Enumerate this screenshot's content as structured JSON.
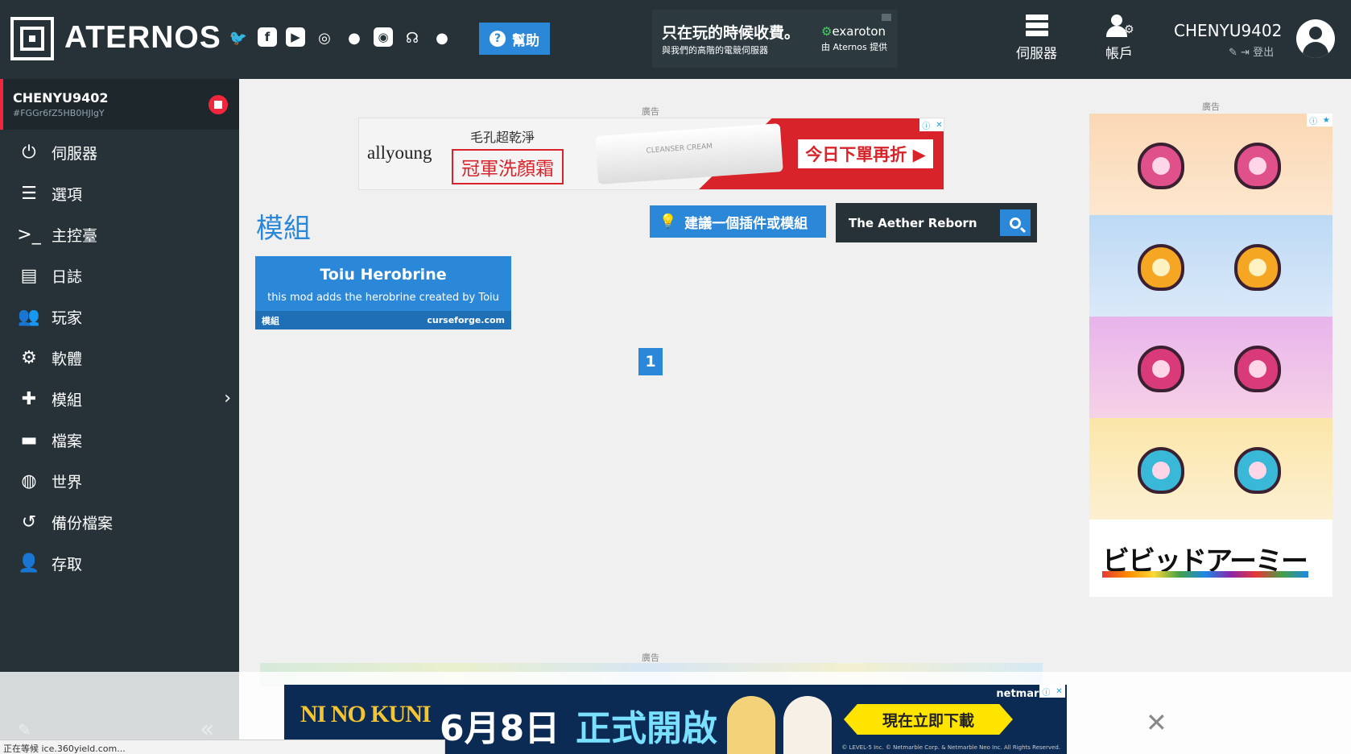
{
  "header": {
    "logo_text": "ATERNOS",
    "social_icons": [
      "twitter-icon",
      "facebook-icon",
      "youtube-icon",
      "instagram-icon",
      "reddit-icon",
      "discord-icon",
      "teamspeak-icon",
      "github-icon"
    ],
    "help_label": "幫助",
    "ad": {
      "headline": "只在玩的時候收費。",
      "subline": "與我們的高階的電競伺服器",
      "brand": "exaroton",
      "brand_sub": "由 Aternos 提供"
    },
    "nav_servers": "伺服器",
    "nav_account": "帳戶",
    "username": "CHENYU9402",
    "logout": "登出"
  },
  "sidebar": {
    "server_name": "CHENYU9402",
    "server_id": "#FGGr6fZ5HB0HJlgY",
    "items": [
      {
        "label": "伺服器",
        "icon": "power-icon"
      },
      {
        "label": "選項",
        "icon": "sliders-icon"
      },
      {
        "label": "主控臺",
        "icon": "terminal-icon"
      },
      {
        "label": "日誌",
        "icon": "file-icon"
      },
      {
        "label": "玩家",
        "icon": "users-icon"
      },
      {
        "label": "軟體",
        "icon": "gears-icon"
      },
      {
        "label": "模組",
        "icon": "puzzle-icon"
      },
      {
        "label": "檔案",
        "icon": "folder-icon"
      },
      {
        "label": "世界",
        "icon": "globe-icon"
      },
      {
        "label": "備份檔案",
        "icon": "history-icon"
      },
      {
        "label": "存取",
        "icon": "user-lock-icon"
      }
    ]
  },
  "main": {
    "ad_label": "廣告",
    "banner": {
      "brand": "allyoung",
      "slogan1": "毛孔超乾淨",
      "slogan2": "冠軍洗顏霜",
      "cta": "今日下單再折 ▶"
    },
    "title": "模組",
    "suggest_label": "建議一個插件或模組",
    "search_value": "The Aether Reborn",
    "mods": [
      {
        "name": "Toiu Herobrine",
        "description": "this mod adds the herobrine created by Toiu",
        "category": "模組",
        "source": "curseforge.com"
      }
    ],
    "pagination": [
      "1"
    ]
  },
  "side_ad": {
    "label": "廣告",
    "title": "ビビッドアーミー"
  },
  "sticky_ad": {
    "logo": "NI NO KUNI",
    "date": "6月8日",
    "open": "正式開啟",
    "download": "現在立即下載",
    "brand": "netmarble",
    "copyright": "© LEVEL-5 Inc. © Netmarble Corp. & Netmarble Neo Inc. All Rights Reserved."
  },
  "status_bar": {
    "text": "正在等候 ice.360yield.com..."
  },
  "colors": {
    "accent": "#2b88d8",
    "dark": "#263238",
    "stop": "#f0263d"
  }
}
